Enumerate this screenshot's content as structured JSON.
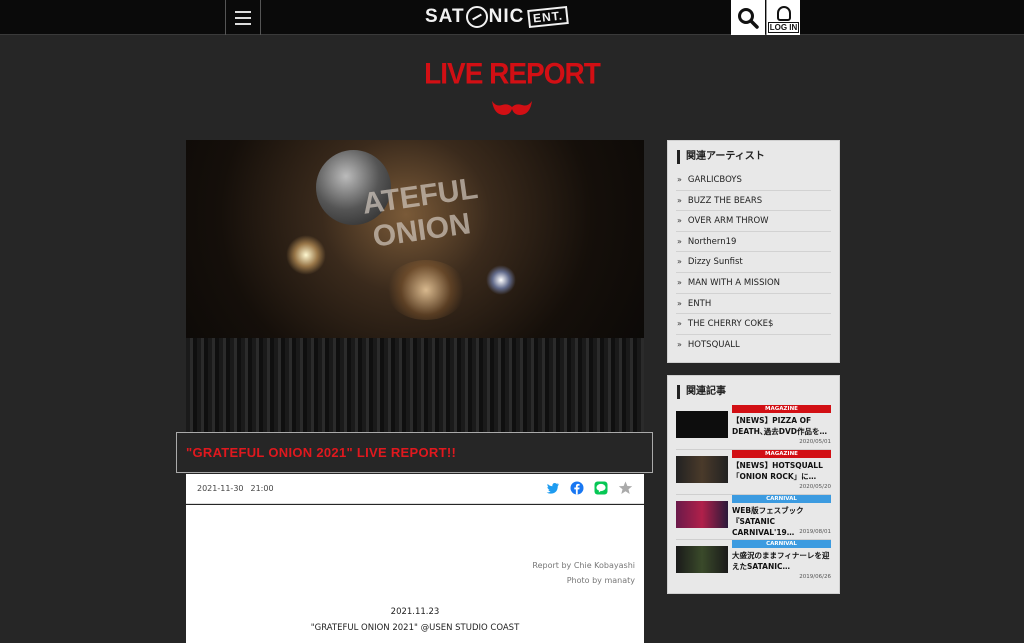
{
  "header": {
    "logo_text_left": "SAT",
    "logo_text_right": "NIC",
    "logo_ent": "ENT.",
    "login_label": "LOG IN",
    "icons": [
      "menu-icon",
      "search-icon",
      "login-mascot-icon"
    ]
  },
  "page": {
    "title": "LIVE REPORT",
    "accent_color": "#d20f14"
  },
  "hero": {
    "banner_text": "ATEFUL ONION"
  },
  "article": {
    "title": "\"GRATEFUL ONION 2021\" LIVE REPORT!!",
    "date": "2021-11-30",
    "time": "21:00",
    "share_icons": [
      "twitter-icon",
      "facebook-icon",
      "line-icon",
      "star-icon"
    ],
    "report_by": "Report by Chie Kobayashi",
    "photo_by": "Photo by manaty",
    "event_date": "2021.11.23",
    "event_name": "\"GRATEFUL ONION 2021\" @USEN STUDIO COAST"
  },
  "sidebar": {
    "artists_heading": "関連アーティスト",
    "artists": [
      "GARLICBOYS",
      "BUZZ THE BEARS",
      "OVER ARM THROW",
      "Northern19",
      "Dizzy Sunfist",
      "MAN WITH A MISSION",
      "ENTH",
      "THE CHERRY COKE$",
      "HOTSQUALL"
    ],
    "articles_heading": "関連記事",
    "articles": [
      {
        "category": "MAGAZINE",
        "cat_color": "#d20f14",
        "title": "【NEWS】PIZZA OF DEATH､過去DVD作品を…",
        "date": "2020/05/01"
      },
      {
        "category": "MAGAZINE",
        "cat_color": "#d20f14",
        "title": "【NEWS】HOTSQUALL「ONION ROCK」に…",
        "date": "2020/05/20"
      },
      {
        "category": "CARNIVAL",
        "cat_color": "#3c9be0",
        "title": "WEB版フェスブック『SATANIC CARNIVAL'19…",
        "date": "2019/08/01"
      },
      {
        "category": "CARNIVAL",
        "cat_color": "#3c9be0",
        "title": "大盛況のままフィナーレを迎えたSATANIC…",
        "date": "2019/06/26"
      }
    ]
  }
}
